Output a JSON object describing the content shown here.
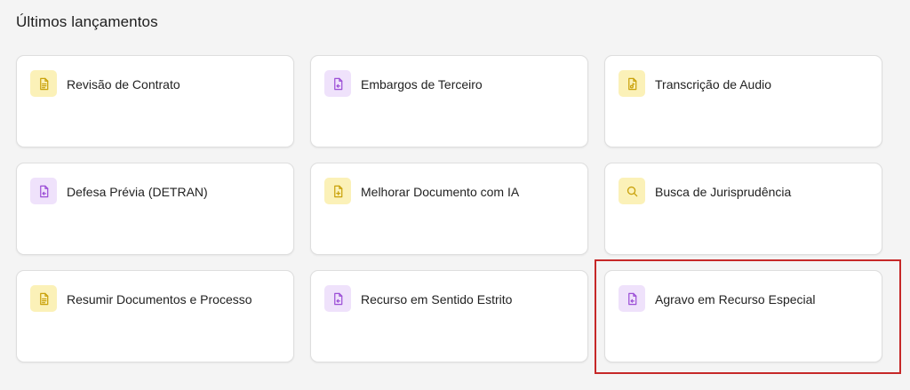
{
  "section": {
    "title": "Últimos lançamentos"
  },
  "colors": {
    "yellow_icon_bg": "#fbf1b8",
    "yellow_icon_fg": "#c9a10a",
    "purple_icon_bg": "#efe2fb",
    "purple_icon_fg": "#9b4ed6",
    "highlight_border": "#c62828"
  },
  "cards": [
    {
      "label": "Revisão de Contrato",
      "icon": "document-lines-icon",
      "tone": "yellow"
    },
    {
      "label": "Embargos de Terceiro",
      "icon": "document-return-icon",
      "tone": "purple"
    },
    {
      "label": "Transcrição de Audio",
      "icon": "document-audio-icon",
      "tone": "yellow"
    },
    {
      "label": "Defesa Prévia (DETRAN)",
      "icon": "document-return-icon",
      "tone": "purple"
    },
    {
      "label": "Melhorar Documento com IA",
      "icon": "document-plus-icon",
      "tone": "yellow"
    },
    {
      "label": "Busca de Jurisprudência",
      "icon": "search-icon",
      "tone": "yellow"
    },
    {
      "label": "Resumir Documentos e Processo",
      "icon": "document-lines-icon",
      "tone": "yellow"
    },
    {
      "label": "Recurso em Sentido Estrito",
      "icon": "document-return-icon",
      "tone": "purple"
    },
    {
      "label": "Agravo em Recurso Especial",
      "icon": "document-return-icon",
      "tone": "purple"
    }
  ]
}
